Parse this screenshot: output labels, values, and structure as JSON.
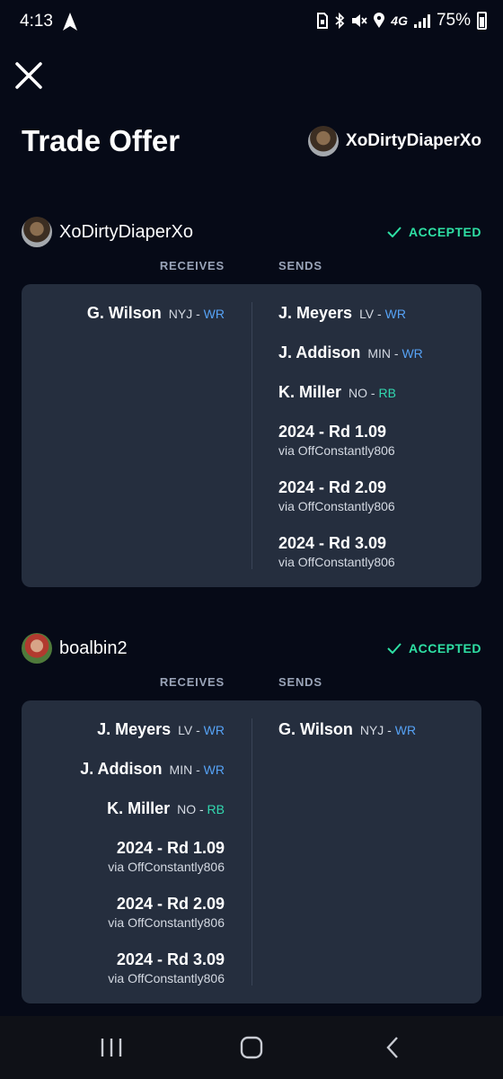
{
  "status_bar": {
    "time": "4:13",
    "battery": "75%",
    "icons": [
      "location-arrow-icon",
      "sim-icon",
      "bluetooth-icon",
      "mute-icon",
      "location-pin-icon",
      "4g-lte-icon",
      "signal-icon",
      "battery-icon"
    ],
    "network": "4G"
  },
  "header": {
    "title": "Trade Offer",
    "user": "XoDirtyDiaperXo"
  },
  "labels": {
    "receives": "RECEIVES",
    "sends": "SENDS"
  },
  "parties": [
    {
      "user": "XoDirtyDiaperXo",
      "status": "ACCEPTED",
      "receives": [
        {
          "kind": "player",
          "name": "G. Wilson",
          "team": "NYJ",
          "sep": " - ",
          "pos": "WR"
        }
      ],
      "sends": [
        {
          "kind": "player",
          "name": "J. Meyers",
          "team": "LV",
          "sep": " - ",
          "pos": "WR"
        },
        {
          "kind": "player",
          "name": "J. Addison",
          "team": "MIN",
          "sep": " - ",
          "pos": "WR"
        },
        {
          "kind": "player",
          "name": "K. Miller",
          "team": "NO",
          "sep": " - ",
          "pos": "RB"
        },
        {
          "kind": "pick",
          "title": "2024 - Rd 1.09",
          "via": "via OffConstantly806"
        },
        {
          "kind": "pick",
          "title": "2024 - Rd 2.09",
          "via": "via OffConstantly806"
        },
        {
          "kind": "pick",
          "title": "2024 - Rd 3.09",
          "via": "via OffConstantly806"
        }
      ]
    },
    {
      "user": "boalbin2",
      "status": "ACCEPTED",
      "receives": [
        {
          "kind": "player",
          "name": "J. Meyers",
          "team": "LV",
          "sep": " - ",
          "pos": "WR"
        },
        {
          "kind": "player",
          "name": "J. Addison",
          "team": "MIN",
          "sep": " - ",
          "pos": "WR"
        },
        {
          "kind": "player",
          "name": "K. Miller",
          "team": "NO",
          "sep": " - ",
          "pos": "RB"
        },
        {
          "kind": "pick",
          "title": "2024 - Rd 1.09",
          "via": "via OffConstantly806"
        },
        {
          "kind": "pick",
          "title": "2024 - Rd 2.09",
          "via": "via OffConstantly806"
        },
        {
          "kind": "pick",
          "title": "2024 - Rd 3.09",
          "via": "via OffConstantly806"
        }
      ],
      "sends": [
        {
          "kind": "player",
          "name": "G. Wilson",
          "team": "NYJ",
          "sep": " - ",
          "pos": "WR"
        }
      ]
    }
  ],
  "colors": {
    "background": "#060a17",
    "card": "#252e3e",
    "accepted": "#2ee0a4",
    "wr": "#56a2f5",
    "rb": "#32d9b0"
  },
  "nav_bar": {
    "buttons": [
      "recents-icon",
      "home-icon",
      "back-icon"
    ]
  }
}
